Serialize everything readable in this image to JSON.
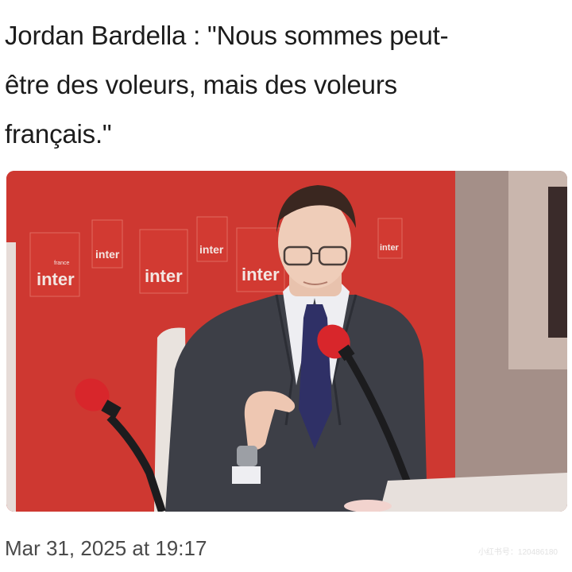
{
  "post": {
    "caption_lines": [
      "Jordan Bardella : \"Nous sommes peut-",
      "être des voleurs, mais des voleurs",
      "français.\""
    ],
    "timestamp": "Mar 31, 2025 at 19:17"
  },
  "photo": {
    "backdrop_logo_text": "inter",
    "backdrop_logo_small": "france",
    "colors": {
      "backdrop": "#c8322c",
      "suit": "#3d3f47",
      "tie": "#2f3066",
      "mic": "#d8262b",
      "wall": "#a48f88"
    }
  },
  "watermark": "小红书号：120486180"
}
